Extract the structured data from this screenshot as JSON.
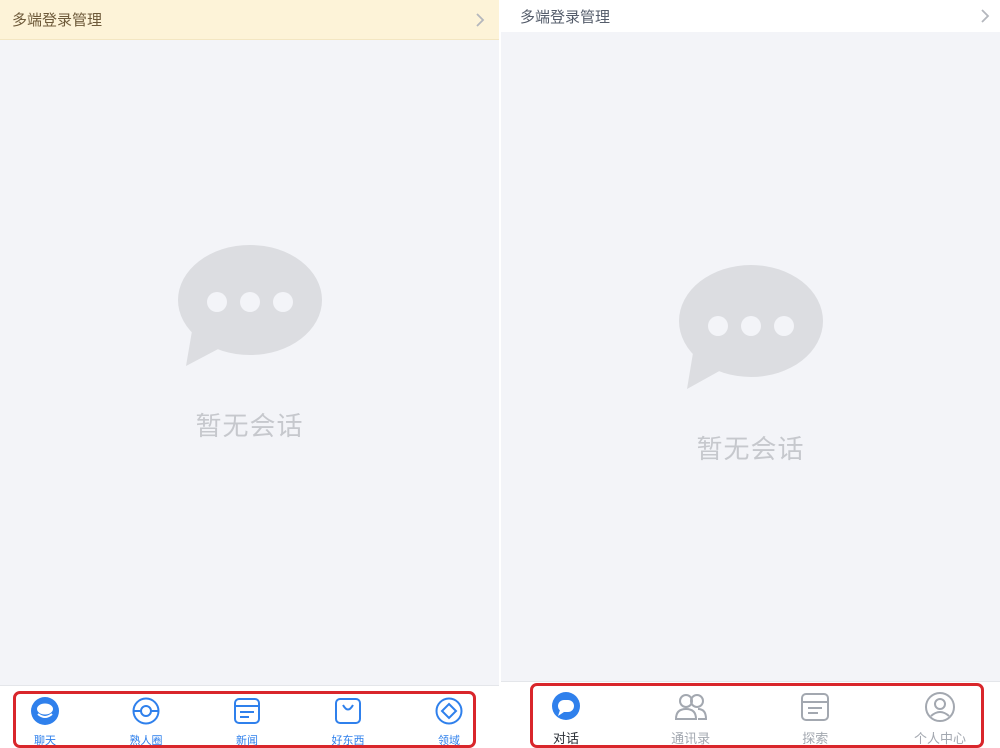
{
  "left": {
    "banner": {
      "label": "多端登录管理",
      "icon": "chevron-right-icon"
    },
    "empty_state": {
      "icon": "chat-bubble-icon",
      "label": "暂无会话"
    },
    "tabs": [
      {
        "label": "聊天",
        "icon": "chat-icon",
        "active": true
      },
      {
        "label": "熟人圈",
        "icon": "circle-eye-icon"
      },
      {
        "label": "新闻",
        "icon": "news-icon"
      },
      {
        "label": "好东西",
        "icon": "shopping-bag-icon"
      },
      {
        "label": "领域",
        "icon": "compass-icon"
      }
    ]
  },
  "right": {
    "banner": {
      "label": "多端登录管理",
      "icon": "chevron-right-icon"
    },
    "empty_state": {
      "icon": "chat-bubble-icon",
      "label": "暂无会话"
    },
    "tabs": [
      {
        "label": "对话",
        "icon": "chat-icon",
        "active": true
      },
      {
        "label": "通讯录",
        "icon": "contacts-icon"
      },
      {
        "label": "探索",
        "icon": "explore-icon"
      },
      {
        "label": "个人中心",
        "icon": "profile-icon"
      }
    ]
  },
  "colors": {
    "accent": "#2f80ec",
    "highlight_box": "#d9262b",
    "banner_warning_bg": "#fdf3d8",
    "empty_icon": "#dcdde1"
  }
}
